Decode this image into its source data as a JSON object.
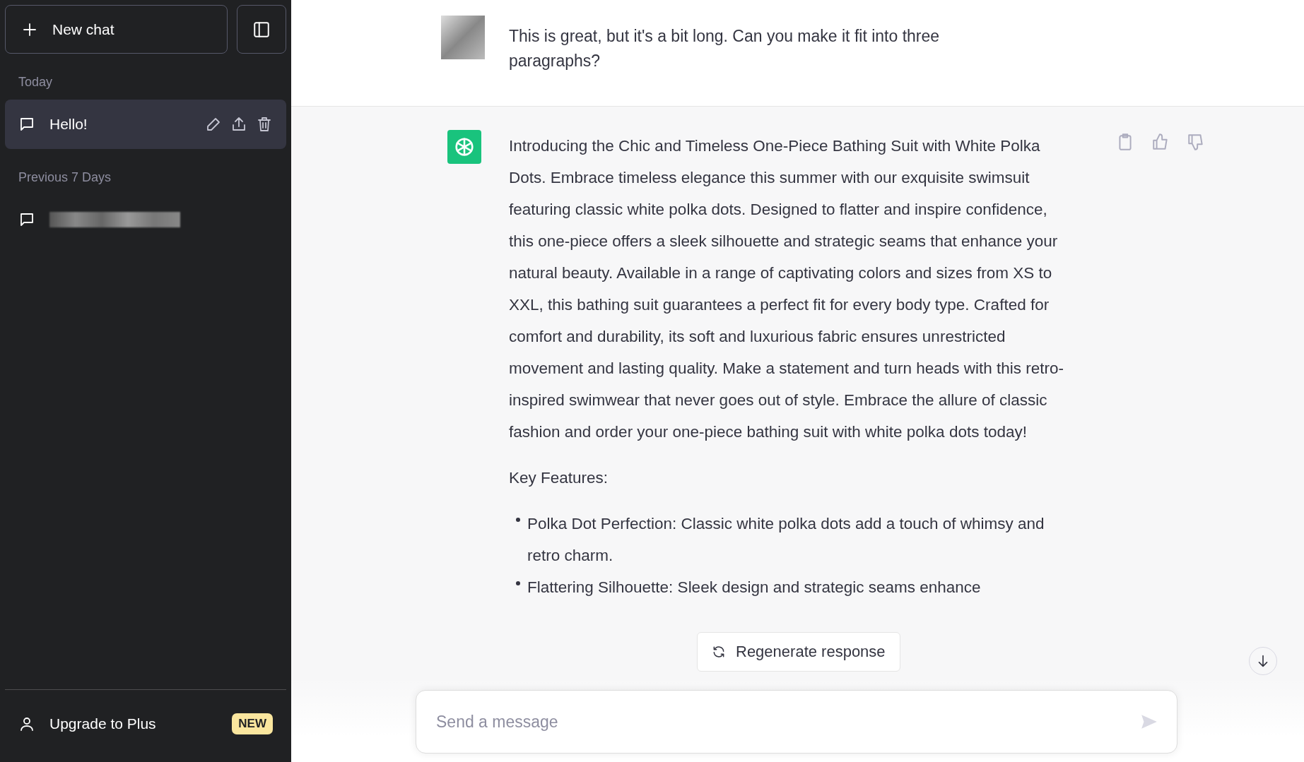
{
  "sidebar": {
    "new_chat": "New chat",
    "sections": [
      {
        "heading": "Today",
        "items": [
          {
            "kind": "text",
            "title": "Hello!",
            "selected": true
          }
        ]
      },
      {
        "heading": "Previous 7 Days",
        "items": [
          {
            "kind": "redacted",
            "selected": false
          }
        ]
      }
    ],
    "upgrade": {
      "label": "Upgrade to Plus",
      "badge": "NEW"
    }
  },
  "conversation": {
    "user_message": "This is great, but it's a bit long. Can you make it fit into three paragraphs?",
    "assistant_message": {
      "paragraph": "Introducing the Chic and Timeless One-Piece Bathing Suit with White Polka Dots. Embrace timeless elegance this summer with our exquisite swimsuit featuring classic white polka dots. Designed to flatter and inspire confidence, this one-piece offers a sleek silhouette and strategic seams that enhance your natural beauty. Available in a range of captivating colors and sizes from XS to XXL, this bathing suit guarantees a perfect fit for every body type. Crafted for comfort and durability, its soft and luxurious fabric ensures unrestricted movement and lasting quality. Make a statement and turn heads with this retro-inspired swimwear that never goes out of style. Embrace the allure of classic fashion and order your one-piece bathing suit with white polka dots today!",
      "subheading": "Key Features:",
      "bullets": [
        "Polka Dot Perfection: Classic white polka dots add a touch of whimsy and retro charm.",
        "Flattering Silhouette: Sleek design and strategic seams enhance"
      ]
    }
  },
  "regenerate": "Regenerate response",
  "composer": {
    "placeholder": "Send a message"
  }
}
